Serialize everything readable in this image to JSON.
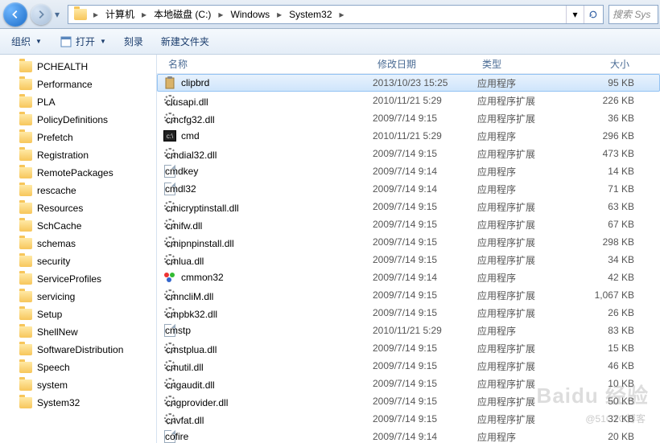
{
  "breadcrumbs": [
    "计算机",
    "本地磁盘 (C:)",
    "Windows",
    "System32"
  ],
  "search_placeholder": "搜索 Sys",
  "toolbar": {
    "organize": "组织",
    "open": "打开",
    "burn": "刻录",
    "new_folder": "新建文件夹"
  },
  "tree": [
    "PCHEALTH",
    "Performance",
    "PLA",
    "PolicyDefinitions",
    "Prefetch",
    "Registration",
    "RemotePackages",
    "rescache",
    "Resources",
    "SchCache",
    "schemas",
    "security",
    "ServiceProfiles",
    "servicing",
    "Setup",
    "ShellNew",
    "SoftwareDistribution",
    "Speech",
    "system",
    "System32"
  ],
  "columns": {
    "name": "名称",
    "date": "修改日期",
    "type": "类型",
    "size": "大小"
  },
  "types": {
    "app": "应用程序",
    "ext": "应用程序扩展"
  },
  "files": [
    {
      "name": "clipbrd",
      "date": "2013/10/23 15:25",
      "type": "app",
      "size": "95 KB",
      "selected": true,
      "icon": "clip"
    },
    {
      "name": "clusapi.dll",
      "date": "2010/11/21 5:29",
      "type": "ext",
      "size": "226 KB",
      "icon": "gear"
    },
    {
      "name": "cmcfg32.dll",
      "date": "2009/7/14 9:15",
      "type": "ext",
      "size": "36 KB",
      "icon": "gear"
    },
    {
      "name": "cmd",
      "date": "2010/11/21 5:29",
      "type": "app",
      "size": "296 KB",
      "icon": "exe"
    },
    {
      "name": "cmdial32.dll",
      "date": "2009/7/14 9:15",
      "type": "ext",
      "size": "473 KB",
      "icon": "gear"
    },
    {
      "name": "cmdkey",
      "date": "2009/7/14 9:14",
      "type": "app",
      "size": "14 KB",
      "icon": "page"
    },
    {
      "name": "cmdl32",
      "date": "2009/7/14 9:14",
      "type": "app",
      "size": "71 KB",
      "icon": "page"
    },
    {
      "name": "cmicryptinstall.dll",
      "date": "2009/7/14 9:15",
      "type": "ext",
      "size": "63 KB",
      "icon": "gear"
    },
    {
      "name": "cmifw.dll",
      "date": "2009/7/14 9:15",
      "type": "ext",
      "size": "67 KB",
      "icon": "gear"
    },
    {
      "name": "cmipnpinstall.dll",
      "date": "2009/7/14 9:15",
      "type": "ext",
      "size": "298 KB",
      "icon": "gear"
    },
    {
      "name": "cmlua.dll",
      "date": "2009/7/14 9:15",
      "type": "ext",
      "size": "34 KB",
      "icon": "gear"
    },
    {
      "name": "cmmon32",
      "date": "2009/7/14 9:14",
      "type": "app",
      "size": "42 KB",
      "icon": "mon"
    },
    {
      "name": "cmncliM.dll",
      "date": "2009/7/14 9:15",
      "type": "ext",
      "size": "1,067 KB",
      "icon": "gear"
    },
    {
      "name": "cmpbk32.dll",
      "date": "2009/7/14 9:15",
      "type": "ext",
      "size": "26 KB",
      "icon": "gear"
    },
    {
      "name": "cmstp",
      "date": "2010/11/21 5:29",
      "type": "app",
      "size": "83 KB",
      "icon": "page"
    },
    {
      "name": "cmstplua.dll",
      "date": "2009/7/14 9:15",
      "type": "ext",
      "size": "15 KB",
      "icon": "gear"
    },
    {
      "name": "cmutil.dll",
      "date": "2009/7/14 9:15",
      "type": "ext",
      "size": "46 KB",
      "icon": "gear"
    },
    {
      "name": "cngaudit.dll",
      "date": "2009/7/14 9:15",
      "type": "ext",
      "size": "10 KB",
      "icon": "gear"
    },
    {
      "name": "cngprovider.dll",
      "date": "2009/7/14 9:15",
      "type": "ext",
      "size": "50 KB",
      "icon": "gear"
    },
    {
      "name": "cnvfat.dll",
      "date": "2009/7/14 9:15",
      "type": "ext",
      "size": "32 KB",
      "icon": "gear"
    },
    {
      "name": "cofire",
      "date": "2009/7/14 9:14",
      "type": "app",
      "size": "20 KB",
      "icon": "page"
    }
  ],
  "watermark": {
    "logo": "Baidu 经验",
    "text": "@51CTO博客"
  }
}
